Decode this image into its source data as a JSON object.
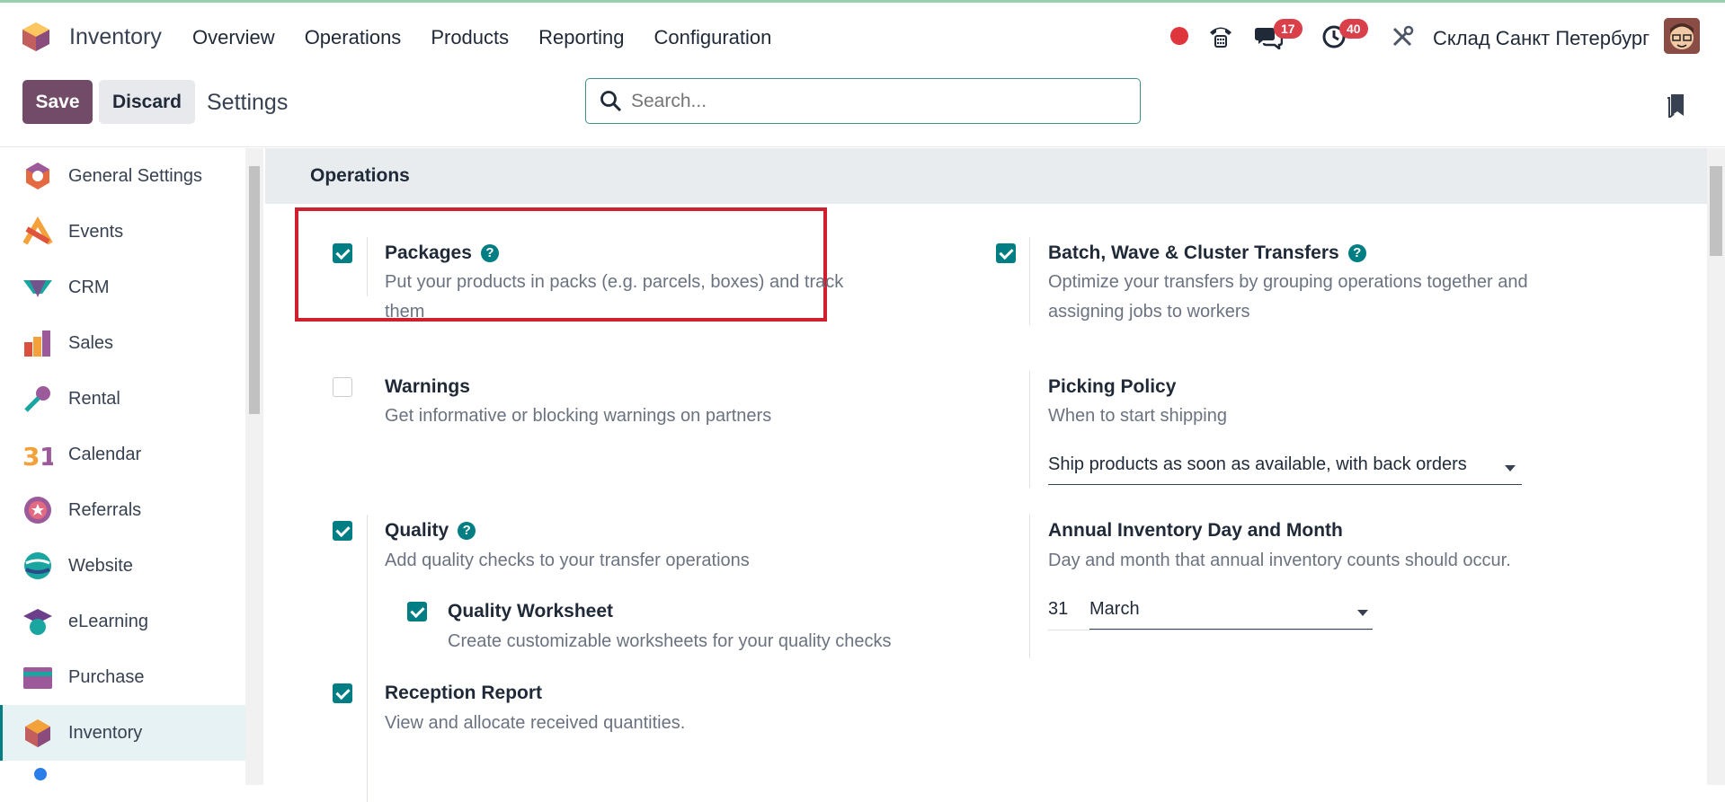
{
  "navbar": {
    "app_name": "Inventory",
    "menu": [
      "Overview",
      "Operations",
      "Products",
      "Reporting",
      "Configuration"
    ],
    "messages_badge": "17",
    "activities_badge": "40",
    "company": "Склад Санкт Петербург"
  },
  "control": {
    "save_label": "Save",
    "discard_label": "Discard",
    "breadcrumb": "Settings",
    "search_placeholder": "Search..."
  },
  "sidebar": {
    "items": [
      {
        "label": "General Settings",
        "icon": "general-settings-icon"
      },
      {
        "label": "Events",
        "icon": "events-icon"
      },
      {
        "label": "CRM",
        "icon": "crm-icon"
      },
      {
        "label": "Sales",
        "icon": "sales-icon"
      },
      {
        "label": "Rental",
        "icon": "rental-icon"
      },
      {
        "label": "Calendar",
        "icon": "calendar-icon"
      },
      {
        "label": "Referrals",
        "icon": "referrals-icon"
      },
      {
        "label": "Website",
        "icon": "website-icon"
      },
      {
        "label": "eLearning",
        "icon": "elearning-icon"
      },
      {
        "label": "Purchase",
        "icon": "purchase-icon"
      },
      {
        "label": "Inventory",
        "icon": "inventory-icon",
        "active": true
      }
    ]
  },
  "section": {
    "title": "Operations"
  },
  "settings": {
    "packages": {
      "title": "Packages",
      "desc": "Put your products in packs (e.g. parcels, boxes) and track them",
      "checked": true
    },
    "batch": {
      "title": "Batch, Wave & Cluster Transfers",
      "desc": "Optimize your transfers by grouping operations together and assigning jobs to workers",
      "checked": true
    },
    "warnings": {
      "title": "Warnings",
      "desc": "Get informative or blocking warnings on partners",
      "checked": false
    },
    "picking": {
      "title": "Picking Policy",
      "desc": "When to start shipping",
      "value": "Ship products as soon as available, with back orders"
    },
    "quality": {
      "title": "Quality",
      "desc": "Add quality checks to your transfer operations",
      "checked": true
    },
    "quality_worksheet": {
      "title": "Quality Worksheet",
      "desc": "Create customizable worksheets for your quality checks",
      "checked": true
    },
    "annual": {
      "title": "Annual Inventory Day and Month",
      "desc": "Day and month that annual inventory counts should occur.",
      "day": "31",
      "month": "March"
    },
    "reception": {
      "title": "Reception Report",
      "desc": "View and allocate received quantities.",
      "checked": true
    }
  },
  "colors": {
    "brand": "#714b67",
    "accent": "#017e84",
    "highlight": "#d01f2e",
    "badge": "#d9404a"
  }
}
